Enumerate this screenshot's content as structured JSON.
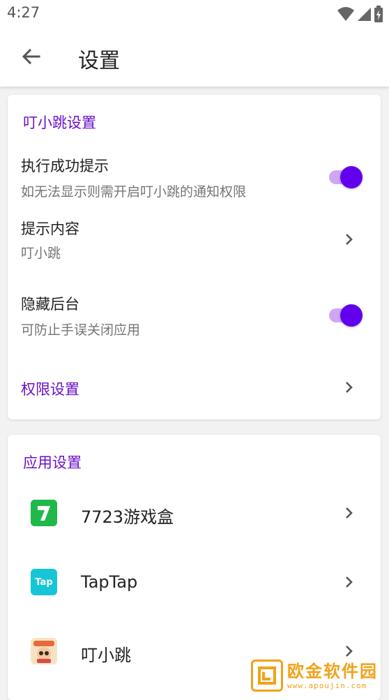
{
  "status_bar": {
    "time": "4:27",
    "icons": [
      "wifi-icon",
      "signal-icon",
      "battery-charging-icon"
    ]
  },
  "app_bar": {
    "title": "设置",
    "back_icon": "arrow-back-icon"
  },
  "colors": {
    "accent": "#6200ee",
    "section_title": "#6a11c9",
    "switch_track": "#cfa7f5",
    "watermark": "#f2a21a"
  },
  "dingxiaotiao_settings": {
    "section_title": "叮小跳设置",
    "success_tip": {
      "title": "执行成功提示",
      "subtitle": "如无法显示则需开启叮小跳的通知权限",
      "enabled": true
    },
    "tip_content": {
      "title": "提示内容",
      "value": "叮小跳"
    },
    "hide_background": {
      "title": "隐藏后台",
      "subtitle": "可防止手误关闭应用",
      "enabled": true
    },
    "permission_settings": {
      "title": "权限设置"
    }
  },
  "app_settings": {
    "section_title": "应用设置",
    "apps": [
      {
        "name": "7723游戏盒",
        "icon": "7723-app-icon"
      },
      {
        "name": "TapTap",
        "icon": "taptap-app-icon",
        "icon_text": "Tap"
      },
      {
        "name": "叮小跳",
        "icon": "dingxiaotiao-app-icon"
      }
    ]
  },
  "watermark": {
    "title": "欧金软件园",
    "subtitle": "www.apoujin.com"
  }
}
